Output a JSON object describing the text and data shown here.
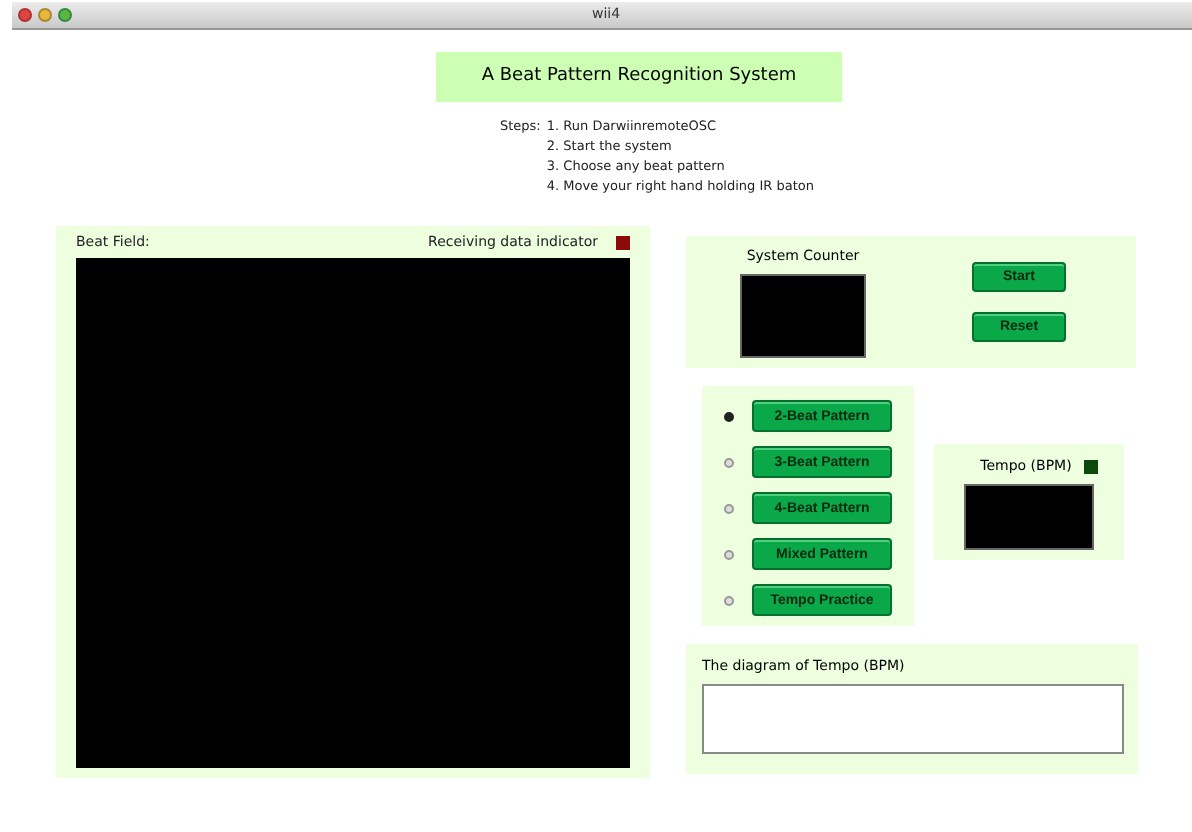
{
  "window": {
    "title": "wii4"
  },
  "header": {
    "title": "A Beat Pattern Recognition System"
  },
  "steps": {
    "label": "Steps:",
    "items": [
      "1. Run DarwiinremoteOSC",
      "2. Start the system",
      "3. Choose any beat pattern",
      "4. Move your right hand holding IR baton"
    ]
  },
  "beat_field": {
    "label": "Beat Field:",
    "indicator_label": "Receiving data indicator",
    "indicator": {
      "color": "#8b0b0b"
    }
  },
  "system_counter": {
    "label": "System Counter",
    "buttons": [
      "Start",
      "Reset"
    ]
  },
  "patterns": [
    {
      "label": "2-Beat Pattern",
      "selected": true
    },
    {
      "label": "3-Beat Pattern",
      "selected": false
    },
    {
      "label": "4-Beat Pattern",
      "selected": false
    },
    {
      "label": "Mixed Pattern",
      "selected": false
    },
    {
      "label": "Tempo Practice",
      "selected": false
    }
  ],
  "tempo": {
    "label": "Tempo (BPM)",
    "indicator": {
      "color": "#0b4a0b"
    }
  },
  "diagram": {
    "label": "The diagram of Tempo (BPM)"
  }
}
